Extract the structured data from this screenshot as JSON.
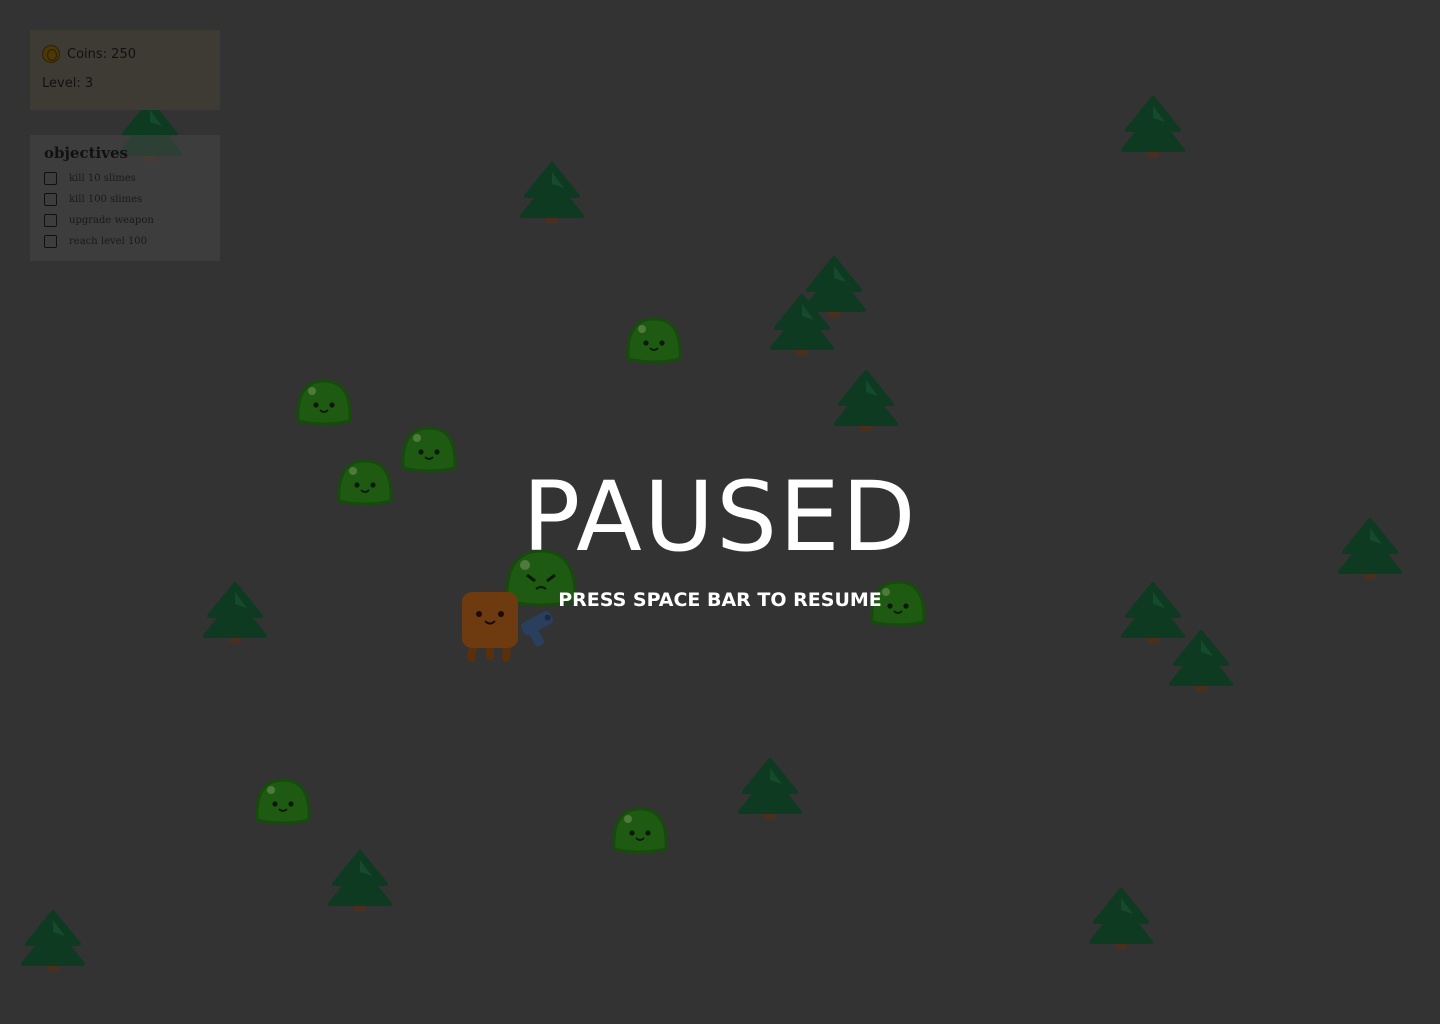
{
  "hud": {
    "coins_label": "Coins: 250",
    "level_label": "Level: 3",
    "coin_icon": "coin-icon"
  },
  "objectives": {
    "title": "objectives",
    "items": [
      {
        "label": "kill 10 slimes",
        "done": false
      },
      {
        "label": "kill 100 slimes",
        "done": false
      },
      {
        "label": "upgrade weapon",
        "done": false
      },
      {
        "label": "reach level 100",
        "done": false
      }
    ]
  },
  "pause": {
    "title": "PAUSED",
    "subtitle": "PRESS SPACE BAR TO RESUME"
  },
  "colors": {
    "background": "#333333",
    "tree": "#0e3a22",
    "trunk": "#4a2f1e",
    "slime": "#1f5a12",
    "player": "#6e3a0f",
    "weapon": "#2a3e5e"
  }
}
